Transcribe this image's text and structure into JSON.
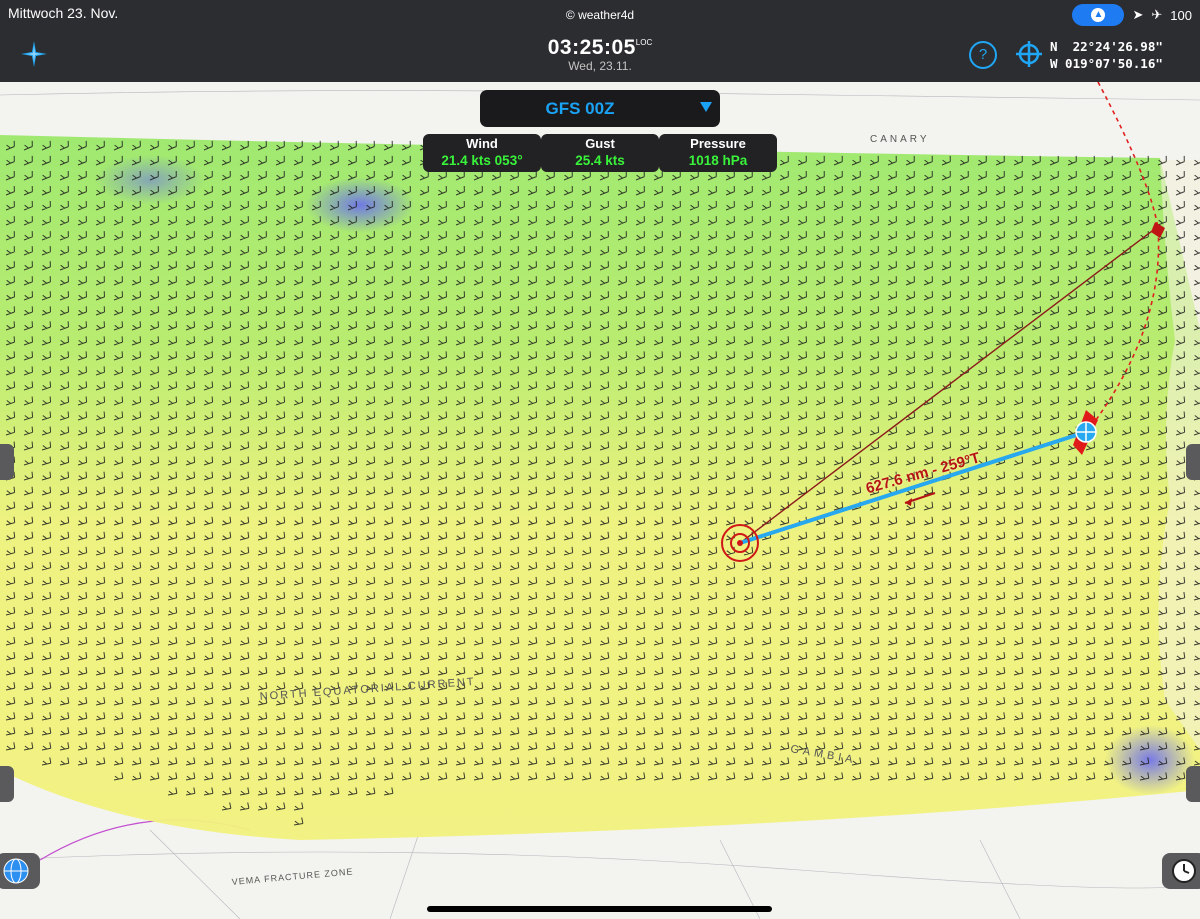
{
  "status_bar": {
    "date": "Mittwoch 23. Nov.",
    "app_name": "© weather4d",
    "battery": "100"
  },
  "header": {
    "time": "03:25:05",
    "time_zone": "LOC",
    "date": "Wed, 23.11.",
    "help_label": "?",
    "latitude": "N  22°24'26.98\"",
    "longitude": "W 019°07'50.16\""
  },
  "model_selector": {
    "selected": "GFS 00Z"
  },
  "readouts": [
    {
      "label": "Wind",
      "value": "21.4 kts 053°"
    },
    {
      "label": "Gust",
      "value": "25.4 kts"
    },
    {
      "label": "Pressure",
      "value": "1018 hPa"
    }
  ],
  "route": {
    "label": "627.6 nm - 259°T"
  },
  "chart_labels": {
    "basin": "CANARY",
    "current": "NORTH EQUATORIAL CURRENT",
    "gambia": "GAMBIA",
    "fracture_zone": "VEMA FRACTURE ZONE"
  },
  "colors": {
    "bar_bg": "#2c2d30",
    "accent_blue": "#1aa3f5",
    "value_green": "#39f33a",
    "route_red": "#b51414",
    "route_blue": "#27a8ef"
  },
  "icons": [
    "compass-icon",
    "help-icon",
    "crosshair-icon",
    "location-arrow-icon",
    "airplane-icon",
    "globe-icon",
    "clock-icon"
  ]
}
